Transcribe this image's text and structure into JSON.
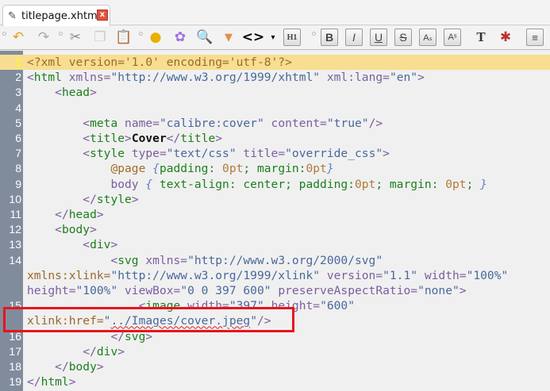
{
  "tab": {
    "title": "titlepage.xhtml",
    "close": "x"
  },
  "toolbar": {
    "icons": [
      "undo-icon",
      "redo-icon",
      "cut-icon",
      "copy-icon",
      "paste-icon",
      "html-check-icon",
      "flower-icon",
      "image-search-icon",
      "insert-image-icon",
      "code-tag-icon",
      "heading-icon",
      "bold-icon",
      "italic-icon",
      "underline-icon",
      "strikethrough-icon",
      "subscript-icon",
      "superscript-icon",
      "text-color-icon",
      "paint-icon",
      "align-icon"
    ],
    "code_label": "<>",
    "heading_label": "H1",
    "bold": "B",
    "italic": "I",
    "underline": "U",
    "strike": "S"
  },
  "lines": [
    {
      "n": "1",
      "cur": true,
      "rows": [
        [
          [
            "<?xml version='1.0' encoding='utf-8'?>",
            "p"
          ]
        ]
      ]
    },
    {
      "n": "2",
      "rows": [
        [
          [
            "<",
            "b"
          ],
          [
            "html",
            "t"
          ],
          [
            " xmlns=",
            "a"
          ],
          [
            "\"http://www.w3.org/1999/xhtml\"",
            "v"
          ],
          [
            " xml:lang=",
            "a"
          ],
          [
            "\"en\"",
            "v"
          ],
          [
            ">",
            "b"
          ]
        ]
      ]
    },
    {
      "n": "3",
      "rows": [
        [
          [
            "    ",
            "w"
          ],
          [
            "<",
            "b"
          ],
          [
            "head",
            "t"
          ],
          [
            ">",
            "b"
          ]
        ]
      ]
    },
    {
      "n": "4",
      "rows": [
        [
          [
            "",
            "w"
          ]
        ]
      ]
    },
    {
      "n": "5",
      "rows": [
        [
          [
            "        ",
            "w"
          ],
          [
            "<",
            "b"
          ],
          [
            "meta",
            "t"
          ],
          [
            " name=",
            "a"
          ],
          [
            "\"calibre:cover\"",
            "v"
          ],
          [
            " content=",
            "a"
          ],
          [
            "\"true\"",
            "v"
          ],
          [
            "/>",
            "b"
          ]
        ]
      ]
    },
    {
      "n": "6",
      "rows": [
        [
          [
            "        ",
            "w"
          ],
          [
            "<",
            "b"
          ],
          [
            "title",
            "t"
          ],
          [
            ">",
            "b"
          ],
          [
            "Cover",
            "x"
          ],
          [
            "</",
            "b"
          ],
          [
            "title",
            "t"
          ],
          [
            ">",
            "b"
          ]
        ]
      ]
    },
    {
      "n": "7",
      "rows": [
        [
          [
            "        ",
            "w"
          ],
          [
            "<",
            "b"
          ],
          [
            "style",
            "t"
          ],
          [
            " type=",
            "a"
          ],
          [
            "\"text/css\"",
            "v"
          ],
          [
            " title=",
            "a"
          ],
          [
            "\"override_css\"",
            "v"
          ],
          [
            ">",
            "b"
          ]
        ]
      ]
    },
    {
      "n": "8",
      "rows": [
        [
          [
            "            ",
            "w"
          ],
          [
            "@page",
            "sel"
          ],
          [
            " {",
            "br"
          ],
          [
            "padding: ",
            "pr"
          ],
          [
            "0pt",
            "n"
          ],
          [
            "; margin:",
            "pr"
          ],
          [
            "0pt",
            "n"
          ],
          [
            "}",
            "br"
          ]
        ]
      ]
    },
    {
      "n": "9",
      "rows": [
        [
          [
            "            ",
            "w"
          ],
          [
            "body",
            "sb"
          ],
          [
            " { ",
            "br"
          ],
          [
            "text-align: center; padding:",
            "pr"
          ],
          [
            "0pt",
            "n"
          ],
          [
            "; margin: ",
            "pr"
          ],
          [
            "0pt",
            "n"
          ],
          [
            "; ",
            "pr"
          ],
          [
            "}",
            "br"
          ]
        ]
      ]
    },
    {
      "n": "10",
      "rows": [
        [
          [
            "        ",
            "w"
          ],
          [
            "</",
            "b"
          ],
          [
            "style",
            "t"
          ],
          [
            ">",
            "b"
          ]
        ]
      ]
    },
    {
      "n": "11",
      "rows": [
        [
          [
            "    ",
            "w"
          ],
          [
            "</",
            "b"
          ],
          [
            "head",
            "t"
          ],
          [
            ">",
            "b"
          ]
        ]
      ]
    },
    {
      "n": "12",
      "rows": [
        [
          [
            "    ",
            "w"
          ],
          [
            "<",
            "b"
          ],
          [
            "body",
            "t"
          ],
          [
            ">",
            "b"
          ]
        ]
      ]
    },
    {
      "n": "13",
      "rows": [
        [
          [
            "        ",
            "w"
          ],
          [
            "<",
            "b"
          ],
          [
            "div",
            "t"
          ],
          [
            ">",
            "b"
          ]
        ]
      ]
    },
    {
      "n": "14",
      "rows": [
        [
          [
            "            ",
            "w"
          ],
          [
            "<",
            "b"
          ],
          [
            "svg",
            "t"
          ],
          [
            " xmlns=",
            "a"
          ],
          [
            "\"http://www.w3.org/2000/svg\"",
            "v"
          ]
        ],
        [
          [
            "xmlns:xlink=",
            "p"
          ],
          [
            "\"http://www.w3.org/1999/xlink\"",
            "v"
          ],
          [
            " version=",
            "a"
          ],
          [
            "\"1.1\"",
            "v"
          ],
          [
            " width=",
            "a"
          ],
          [
            "\"100%\"",
            "v"
          ]
        ],
        [
          [
            "height=",
            "a"
          ],
          [
            "\"100%\"",
            "v"
          ],
          [
            " viewBox=",
            "a"
          ],
          [
            "\"0 0 397 600\"",
            "v"
          ],
          [
            " preserveAspectRatio=",
            "a"
          ],
          [
            "\"none\"",
            "v"
          ],
          [
            ">",
            "b"
          ]
        ]
      ]
    },
    {
      "n": "15",
      "rows": [
        [
          [
            "                ",
            "w"
          ],
          [
            "<",
            "b"
          ],
          [
            "image",
            "t"
          ],
          [
            " width=",
            "a"
          ],
          [
            "\"397\"",
            "v"
          ],
          [
            " height=",
            "a"
          ],
          [
            "\"600\"",
            "v"
          ]
        ],
        [
          [
            "xlink:href=",
            "p"
          ],
          [
            "\"",
            "v"
          ],
          [
            "../Images/cover.jpeg",
            "v sq"
          ],
          [
            "\"",
            "v"
          ],
          [
            "/>",
            "b"
          ]
        ]
      ]
    },
    {
      "n": "16",
      "rows": [
        [
          [
            "            ",
            "w"
          ],
          [
            "</",
            "b"
          ],
          [
            "svg",
            "t"
          ],
          [
            ">",
            "b"
          ]
        ]
      ]
    },
    {
      "n": "17",
      "rows": [
        [
          [
            "        ",
            "w"
          ],
          [
            "</",
            "b"
          ],
          [
            "div",
            "t"
          ],
          [
            ">",
            "b"
          ]
        ]
      ]
    },
    {
      "n": "18",
      "rows": [
        [
          [
            "    ",
            "w"
          ],
          [
            "</",
            "b"
          ],
          [
            "body",
            "t"
          ],
          [
            ">",
            "b"
          ]
        ]
      ]
    },
    {
      "n": "19",
      "rows": [
        [
          [
            "</",
            "b"
          ],
          [
            "html",
            "t"
          ],
          [
            ">",
            "b"
          ]
        ]
      ]
    }
  ],
  "colors": {
    "highlight": "#e8141e",
    "current_line": "#f8de90",
    "gutter": "#808c9c"
  }
}
